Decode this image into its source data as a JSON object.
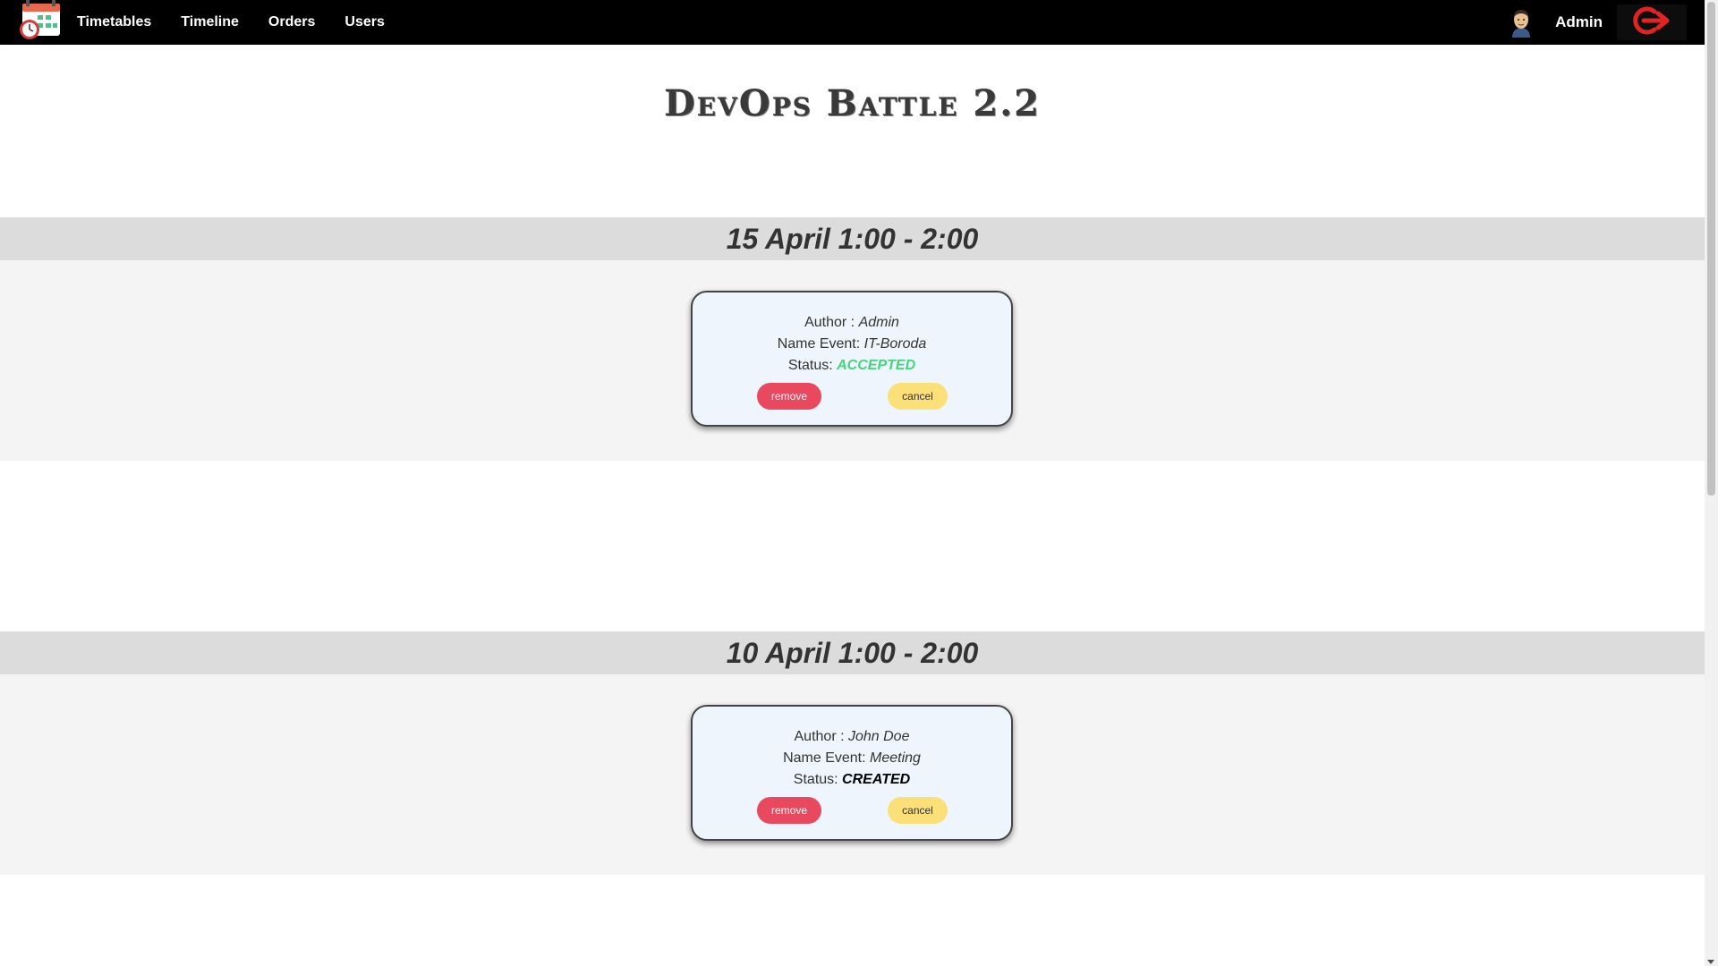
{
  "nav": {
    "links": [
      "Timetables",
      "Timeline",
      "Orders",
      "Users"
    ],
    "user_name": "Admin",
    "logo_icon": "calendar-clock-icon",
    "avatar_icon": "user-avatar-icon",
    "logout_icon": "logout-arrow-icon"
  },
  "page": {
    "title": "DevOps Battle 2.2"
  },
  "timetables": [
    {
      "date_range": "15 April 1:00 - 2:00",
      "author_label": "Author : ",
      "author": "Admin",
      "event_label": "Name Event: ",
      "event": "IT-Boroda",
      "status_label": "Status: ",
      "status": "ACCEPTED",
      "remove_label": "remove",
      "cancel_label": "cancel"
    },
    {
      "date_range": "10 April 1:00 - 2:00",
      "author_label": "Author : ",
      "author": "John Doe",
      "event_label": "Name Event: ",
      "event": "Meeting",
      "status_label": "Status: ",
      "status": "CREATED",
      "remove_label": "remove",
      "cancel_label": "cancel"
    }
  ],
  "colors": {
    "status_accepted": "#46d37f",
    "status_created": "#000000",
    "remove_button": "#e8495f",
    "cancel_button": "#fbe07a"
  }
}
